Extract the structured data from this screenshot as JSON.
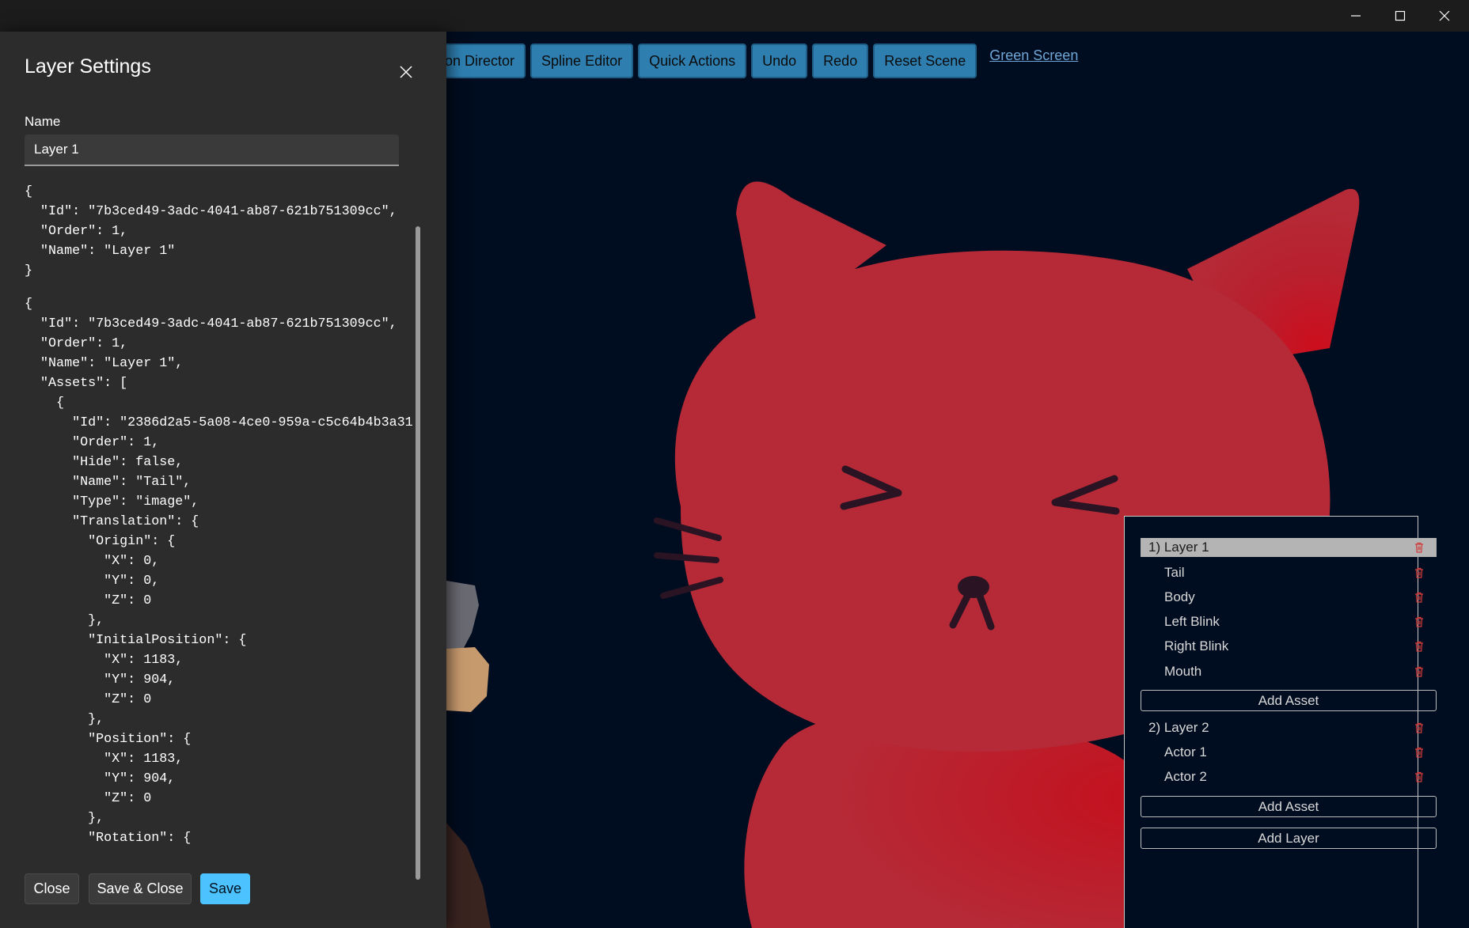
{
  "window": {
    "controls": [
      "minimize-icon",
      "maximize-icon",
      "close-icon"
    ]
  },
  "toolbar": {
    "buttons": [
      "on Director",
      "Spline Editor",
      "Quick Actions",
      "Undo",
      "Redo",
      "Reset Scene"
    ],
    "link": "Green Screen"
  },
  "dialog": {
    "title": "Layer Settings",
    "name_label": "Name",
    "name_value": "Layer 1",
    "json_summary": "{\n  \"Id\": \"7b3ced49-3adc-4041-ab87-621b751309cc\",\n  \"Order\": 1,\n  \"Name\": \"Layer 1\"\n}",
    "json_full": "{\n  \"Id\": \"7b3ced49-3adc-4041-ab87-621b751309cc\",\n  \"Order\": 1,\n  \"Name\": \"Layer 1\",\n  \"Assets\": [\n    {\n      \"Id\": \"2386d2a5-5a08-4ce0-959a-c5c64b4b3a31\",\n      \"Order\": 1,\n      \"Hide\": false,\n      \"Name\": \"Tail\",\n      \"Type\": \"image\",\n      \"Translation\": {\n        \"Origin\": {\n          \"X\": 0,\n          \"Y\": 0,\n          \"Z\": 0\n        },\n        \"InitialPosition\": {\n          \"X\": 1183,\n          \"Y\": 904,\n          \"Z\": 0\n        },\n        \"Position\": {\n          \"X\": 1183,\n          \"Y\": 904,\n          \"Z\": 0\n        },\n        \"Rotation\": {",
    "buttons": {
      "close": "Close",
      "save_close": "Save & Close",
      "save": "Save"
    }
  },
  "layers_panel": {
    "layers": [
      {
        "label": "1) Layer 1",
        "selected": true,
        "assets": [
          "Tail",
          "Body",
          "Left Blink",
          "Right Blink",
          "Mouth"
        ]
      },
      {
        "label": "2) Layer 2",
        "selected": false,
        "assets": [
          "Actor 1",
          "Actor 2"
        ]
      }
    ],
    "add_asset_label": "Add Asset",
    "add_layer_label": "Add Layer"
  },
  "colors": {
    "canvas_bg": "#000c1f",
    "cat_red": "#b52a36",
    "toolbar_button": "#2e7fb0",
    "primary_button": "#4cc2ff",
    "dialog_bg": "#2c2c2c",
    "delete_icon": "#d23c3c"
  }
}
